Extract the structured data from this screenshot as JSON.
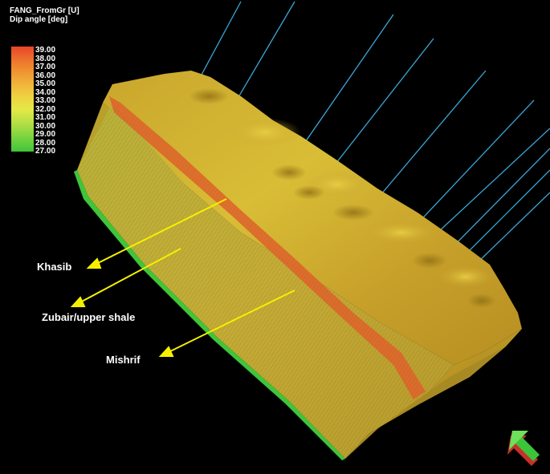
{
  "legend": {
    "property": "FANG_FromGr [U]",
    "subtitle": "Dip angle [deg]",
    "ticks": [
      "39.00",
      "38.00",
      "37.00",
      "36.00",
      "35.00",
      "34.00",
      "33.00",
      "32.00",
      "31.00",
      "30.00",
      "29.00",
      "28.00",
      "27.00"
    ],
    "colors": {
      "max": "#e8442a",
      "mid": "#efd341",
      "min": "#3fc43a"
    }
  },
  "annotations": {
    "khasib": "Khasib",
    "zubair": "Zubair/upper shale",
    "mishrif": "Mishrif"
  },
  "colors": {
    "background": "#000000",
    "well_line": "#3aa6d6",
    "arrow": "#f5f000",
    "block_face": "#c8b22e",
    "band": "#e06a2c"
  },
  "widgets": {
    "orientation": "orientation-arrow-icon"
  }
}
